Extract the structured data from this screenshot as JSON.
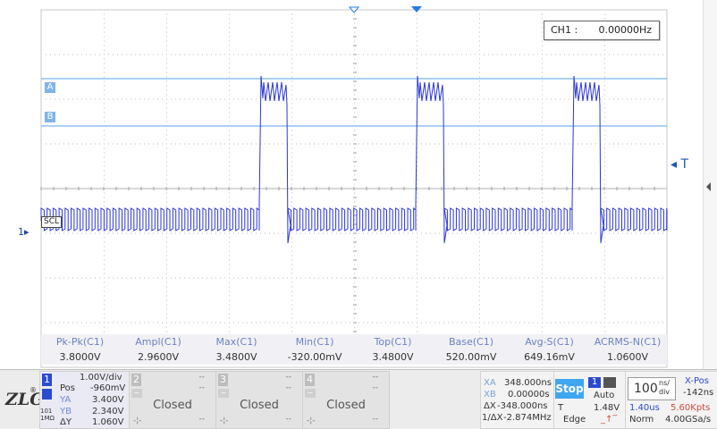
{
  "scope": {
    "frequency_counter": {
      "label": "CH1 :",
      "value": "0.00000Hz"
    },
    "cursor_a_label": "A",
    "cursor_b_label": "B",
    "trigger_marker": "T",
    "channel1_marker": "1",
    "bus_label": "SCL"
  },
  "measurements": [
    {
      "name": "Pk-Pk(C1)",
      "value": "3.8000V"
    },
    {
      "name": "Ampl(C1)",
      "value": "2.9600V"
    },
    {
      "name": "Max(C1)",
      "value": "3.4800V"
    },
    {
      "name": "Min(C1)",
      "value": "-320.00mV"
    },
    {
      "name": "Top(C1)",
      "value": "3.4800V"
    },
    {
      "name": "Base(C1)",
      "value": "520.00mV"
    },
    {
      "name": "Avg-S(C1)",
      "value": "649.16mV"
    },
    {
      "name": "ACRMS-N(C1)",
      "value": "1.0600V"
    }
  ],
  "bottom": {
    "logo": "ZLG",
    "logo_reg": "®",
    "channel1": {
      "number": "1",
      "scale": "1.00V/div",
      "pos_label": "Pos",
      "pos_value": "-960mV",
      "ya_label": "YA",
      "ya_value": "3.400V",
      "yb_label": "YB",
      "yb_value": "2.340V",
      "dy_label": "ΔY",
      "dy_value": "1.060V",
      "side_text": "101 1MΩ"
    },
    "channels_closed": [
      {
        "number": "2",
        "status": "Closed"
      },
      {
        "number": "3",
        "status": "Closed"
      },
      {
        "number": "4",
        "status": "Closed"
      }
    ],
    "placeholder_dash": "--",
    "cursors": {
      "xa_label": "XA",
      "xa_value": "348.000ns",
      "xb_label": "XB",
      "xb_value": "0.00000s",
      "dx_label": "ΔX",
      "dx_value": "-348.000ns",
      "inv_label": "1/ΔX",
      "inv_value": "-2.874MHz"
    },
    "trigger": {
      "run_state": "Stop",
      "source": "1",
      "mode": "Auto",
      "t_label": "T",
      "level": "1.48V",
      "type": "Edge"
    },
    "timebase": {
      "value": "100",
      "unit_top": "ns/",
      "unit_bottom": "div",
      "xpos_label": "X-Pos",
      "xpos_value": "-142ns",
      "time_value": "1.40us",
      "points": "5.60Kpts",
      "acq_mode": "Norm",
      "sample_rate": "4.00GSa/s"
    }
  }
}
